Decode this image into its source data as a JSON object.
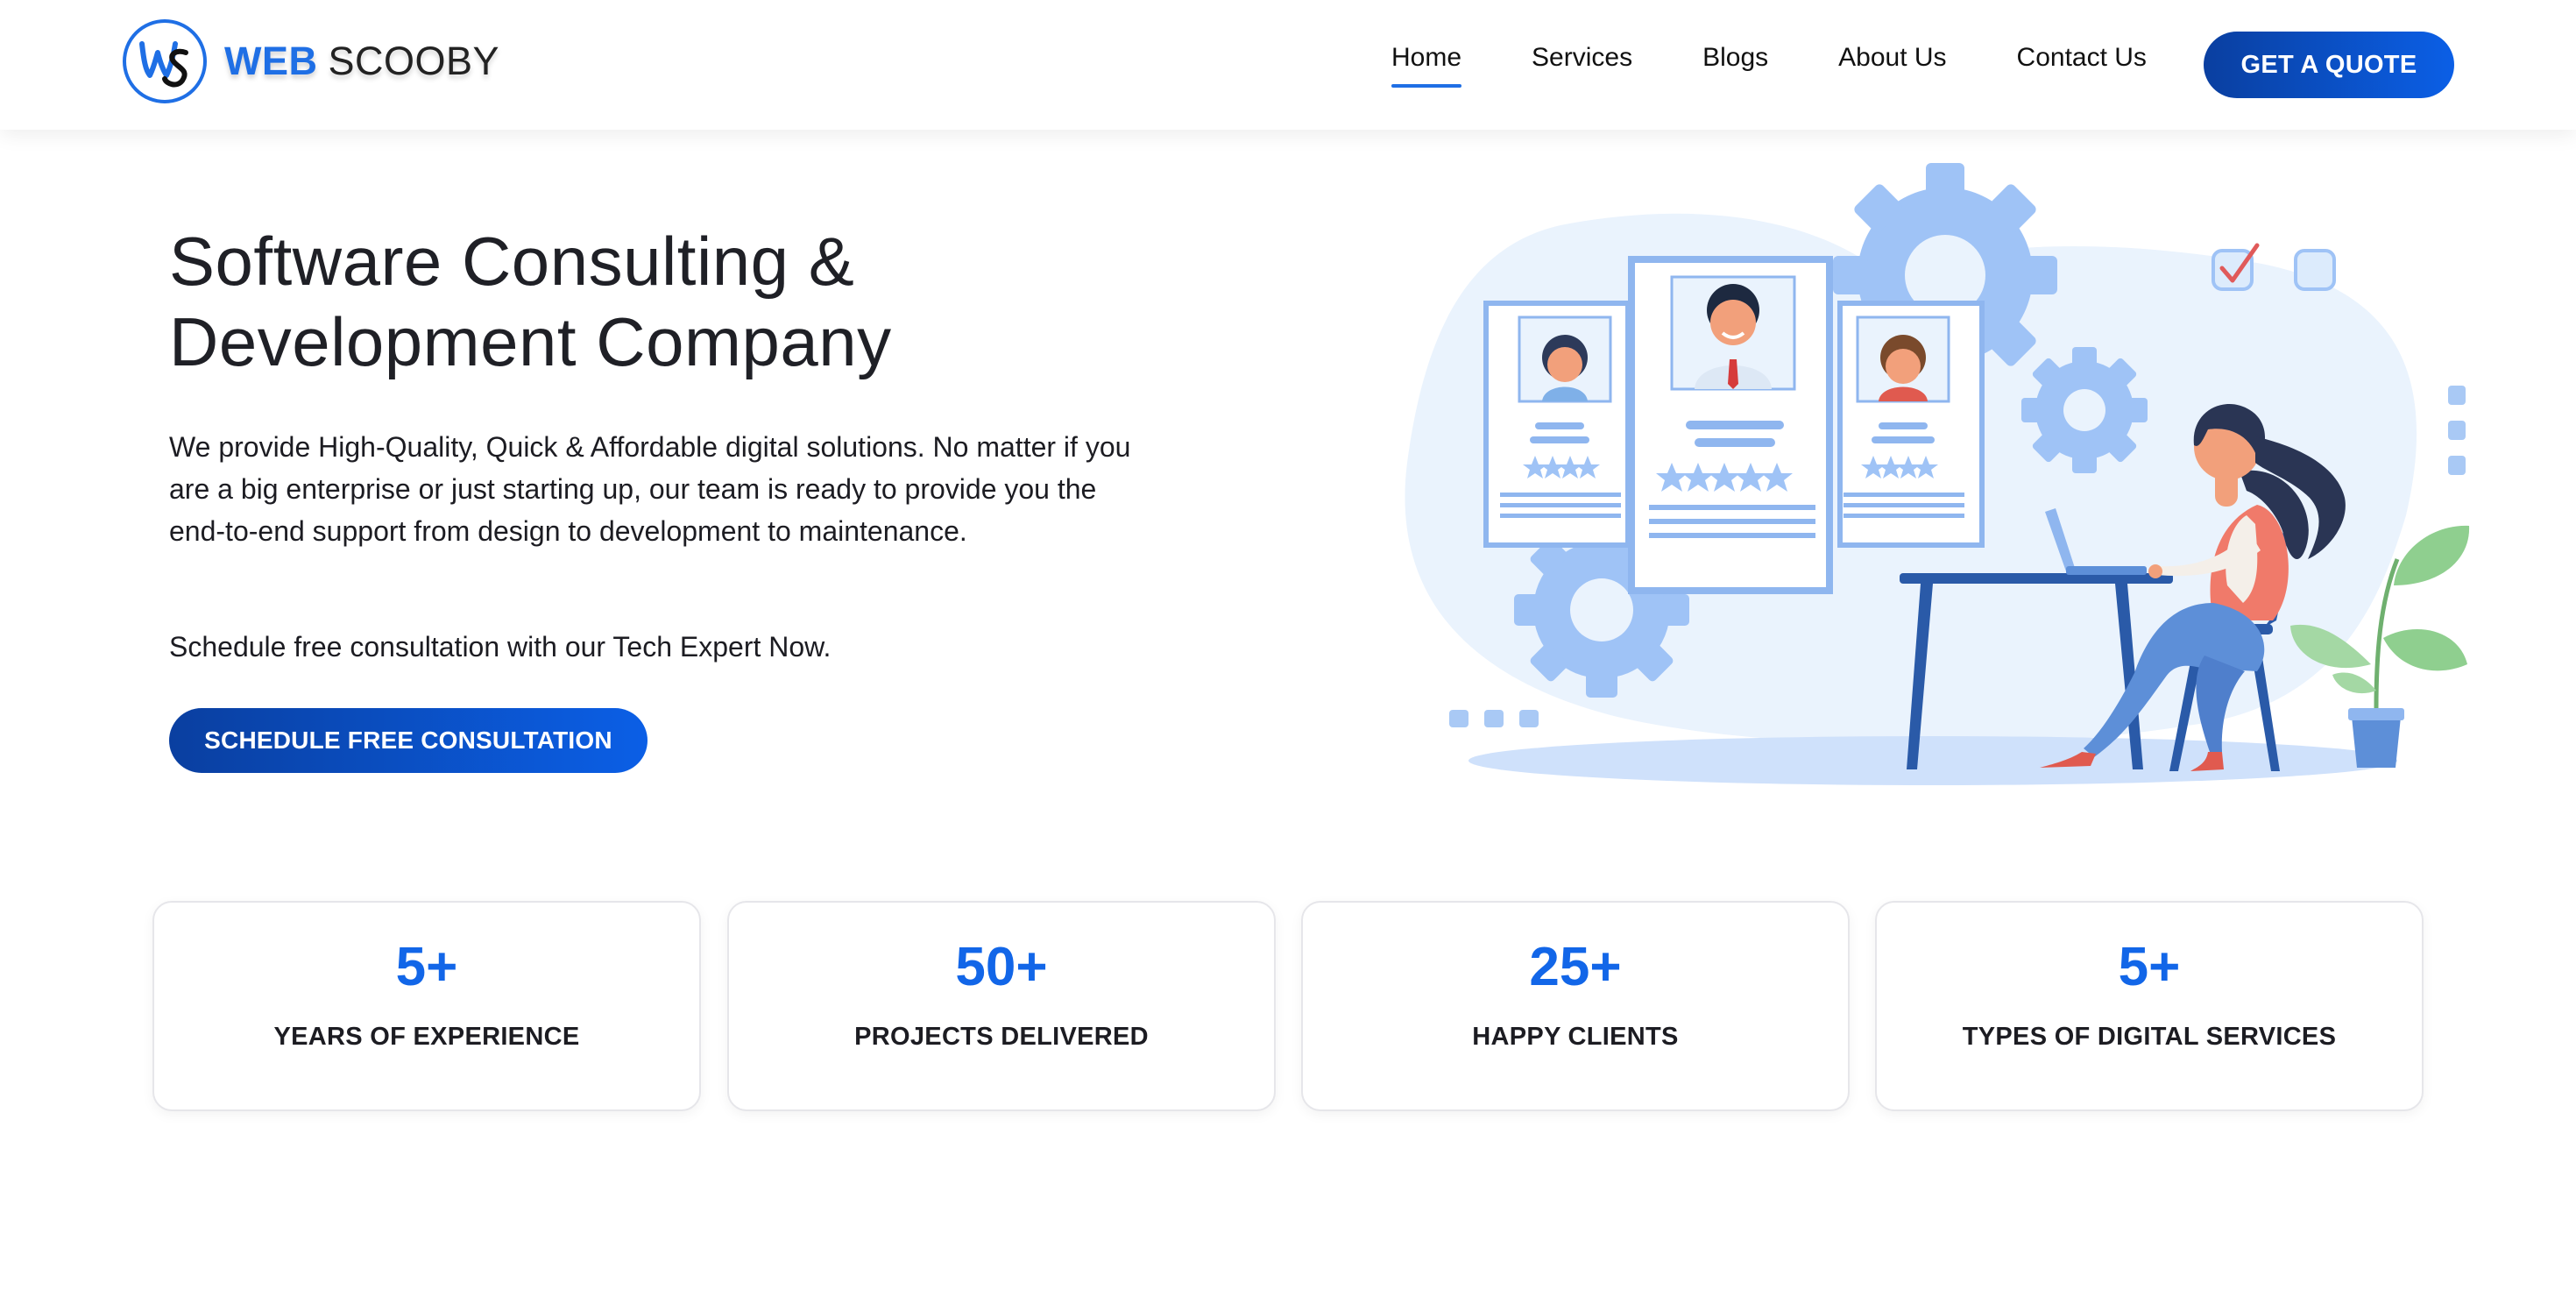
{
  "brand": {
    "logo_mark": "WS",
    "name_primary": "WEB",
    "name_secondary": "SCOOBY",
    "primary_color": "#1f6fe5",
    "button_gradient": [
      "#0a3fa0",
      "#0b5fe6"
    ]
  },
  "nav": {
    "items": [
      {
        "label": "Home",
        "active": true
      },
      {
        "label": "Services",
        "active": false
      },
      {
        "label": "Blogs",
        "active": false
      },
      {
        "label": "About Us",
        "active": false
      },
      {
        "label": "Contact Us",
        "active": false
      }
    ],
    "cta_label": "GET A QUOTE"
  },
  "hero": {
    "title_line1": "Software Consulting &",
    "title_line2": "Development Company",
    "description": "We provide High-Quality, Quick & Affordable digital solutions. No matter if you are a big enterprise or just starting up, our team is ready to provide you the end-to-end support from design to development to maintenance.",
    "cta_text": "Schedule free consultation with our Tech Expert Now.",
    "cta_button": "SCHEDULE FREE CONSULTATION",
    "illustration": "woman-working-laptop-with-profile-cards-illustration"
  },
  "stats": [
    {
      "value": "5+",
      "label": "YEARS OF EXPERIENCE"
    },
    {
      "value": "50+",
      "label": "PROJECTS DELIVERED"
    },
    {
      "value": "25+",
      "label": "HAPPY CLIENTS"
    },
    {
      "value": "5+",
      "label": "TYPES OF DIGITAL SERVICES"
    }
  ]
}
